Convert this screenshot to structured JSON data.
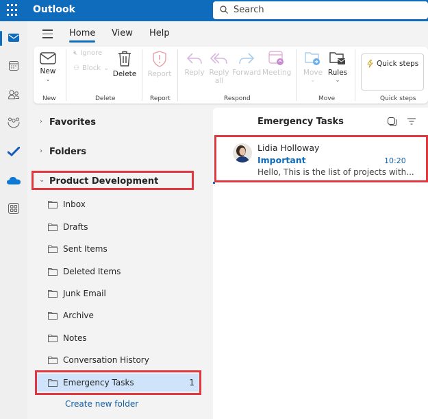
{
  "app": {
    "title": "Outlook"
  },
  "search": {
    "placeholder": "Search"
  },
  "left_rail": {
    "items": [
      {
        "name": "mail",
        "active": true
      },
      {
        "name": "calendar"
      },
      {
        "name": "people"
      },
      {
        "name": "groups"
      },
      {
        "name": "to-do"
      },
      {
        "name": "onedrive"
      },
      {
        "name": "apps"
      }
    ]
  },
  "tabs": [
    {
      "label": "Home",
      "active": true
    },
    {
      "label": "View"
    },
    {
      "label": "Help"
    }
  ],
  "ribbon": {
    "groups": {
      "new": "New",
      "delete": "Delete",
      "report": "Report",
      "respond": "Respond",
      "move": "Move",
      "quick_steps": "Quick steps"
    },
    "buttons": {
      "new": "New",
      "ignore": "Ignore",
      "block": "Block",
      "delete": "Delete",
      "report": "Report",
      "reply": "Reply",
      "reply_all_1": "Reply",
      "reply_all_2": "all",
      "forward": "Forward",
      "meeting": "Meeting",
      "move": "Move",
      "rules": "Rules",
      "quick_steps": "Quick steps"
    }
  },
  "nav": {
    "favorites": "Favorites",
    "folders": "Folders",
    "account": "Product Development",
    "folder_list": [
      {
        "label": "Inbox"
      },
      {
        "label": "Drafts"
      },
      {
        "label": "Sent Items"
      },
      {
        "label": "Deleted Items"
      },
      {
        "label": "Junk Email"
      },
      {
        "label": "Archive"
      },
      {
        "label": "Notes"
      },
      {
        "label": "Conversation History"
      },
      {
        "label": "Emergency Tasks",
        "count": "1",
        "selected": true
      }
    ],
    "create_folder": "Create new folder"
  },
  "message_list": {
    "title": "Emergency Tasks",
    "messages": [
      {
        "sender": "Lidia Holloway",
        "subject": "Important",
        "time": "10:20",
        "preview": "Hello, This is the list of projects with..."
      }
    ]
  },
  "colors": {
    "brand": "#0f6cbd",
    "highlight": "#e0383e",
    "selected": "#cfe4fa"
  }
}
